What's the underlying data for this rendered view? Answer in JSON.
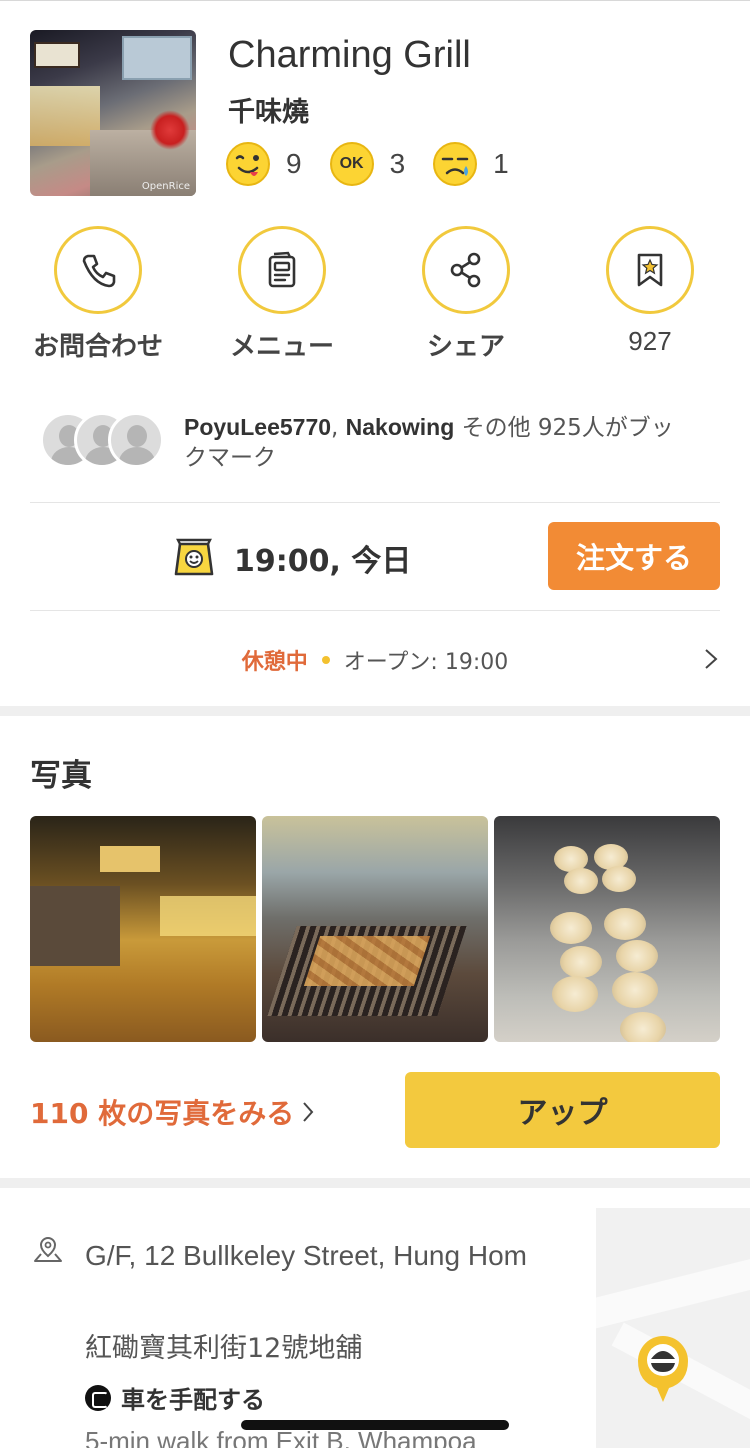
{
  "restaurant": {
    "name": "Charming Grill",
    "name_local": "千味燒",
    "photo_watermark": "OpenRice"
  },
  "ratings": [
    {
      "icon": "smile-face-icon",
      "count": "9"
    },
    {
      "icon": "ok-face-icon",
      "count": "3"
    },
    {
      "icon": "sad-face-icon",
      "count": "1"
    }
  ],
  "actions": {
    "contact": "お問合わせ",
    "menu": "メニュー",
    "share": "シェア",
    "bookmark_count": "927"
  },
  "bookmarks": {
    "user1": "PoyuLee5770",
    "separator": ", ",
    "user2": "Nakowing",
    "rest": " その他 925人がブックマーク"
  },
  "order": {
    "time": "19:00, 今日",
    "button": "注文する"
  },
  "status": {
    "closed": "休憩中",
    "open": "オープン: 19:00"
  },
  "photos": {
    "title": "写真",
    "see_all": "110 枚の写真をみる",
    "upload": "アップ"
  },
  "address": {
    "en": "G/F, 12 Bullkeley Street, Hung Hom",
    "cn": "紅磡寶其利街12號地舖",
    "ride": "車を手配する",
    "walk": "5-min walk from Exit B, Whampoa"
  },
  "colors": {
    "accent_yellow": "#f3c93e",
    "accent_orange": "#f28b35",
    "status_red": "#e06a3a"
  }
}
